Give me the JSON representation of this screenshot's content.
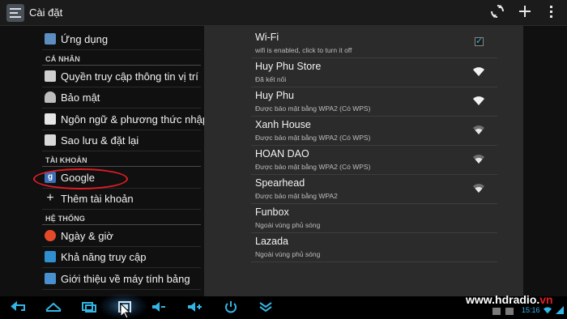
{
  "actionbar": {
    "title": "Cài đặt",
    "sync_icon": "sync-icon",
    "add_icon": "add-icon",
    "overflow_icon": "overflow-menu-icon"
  },
  "left_pane": {
    "apps_label": "Ứng dụng",
    "personal_header": "CÁ NHÂN",
    "location_label": "Quyền truy cập thông tin vị trí",
    "security_label": "Bảo mật",
    "language_label": "Ngôn ngữ & phương thức nhập",
    "backup_label": "Sao lưu & đặt lại",
    "accounts_header": "TÀI KHOẢN",
    "google_label": "Google",
    "add_account_label": "Thêm tài khoản",
    "system_header": "HỆ THỐNG",
    "datetime_label": "Ngày & giờ",
    "accessibility_label": "Khả năng truy cập",
    "about_label": "Giới thiệu về máy tính bảng"
  },
  "wifi": {
    "toggle_title": "Wi-Fi",
    "toggle_status": "wifi is enabled, click to turn it off",
    "toggle_checked": true,
    "networks": [
      {
        "name": "Huy Phu Store",
        "status": "Đã kết nối",
        "signal": "strong"
      },
      {
        "name": "Huy Phu",
        "status": "Được bảo mật bằng WPA2 (Có WPS)",
        "signal": "strong"
      },
      {
        "name": "Xanh House",
        "status": "Được bảo mật bằng WPA2 (Có WPS)",
        "signal": "medium"
      },
      {
        "name": "HOAN DAO",
        "status": "Được bảo mật bằng WPA2 (Có WPS)",
        "signal": "medium"
      },
      {
        "name": "Spearhead",
        "status": "Được bảo mật bằng WPA2",
        "signal": "medium"
      },
      {
        "name": "Funbox",
        "status": "Ngoài vùng phủ sóng",
        "signal": "none"
      },
      {
        "name": "Lazada",
        "status": "Ngoài vùng phủ sóng",
        "signal": "none"
      }
    ]
  },
  "navbar": {
    "clock": "15:16",
    "watermark_main": "www.hdradio.",
    "watermark_suffix": "vn"
  },
  "colors": {
    "accent": "#33b5e5",
    "highlight_oval": "#e01d24"
  }
}
